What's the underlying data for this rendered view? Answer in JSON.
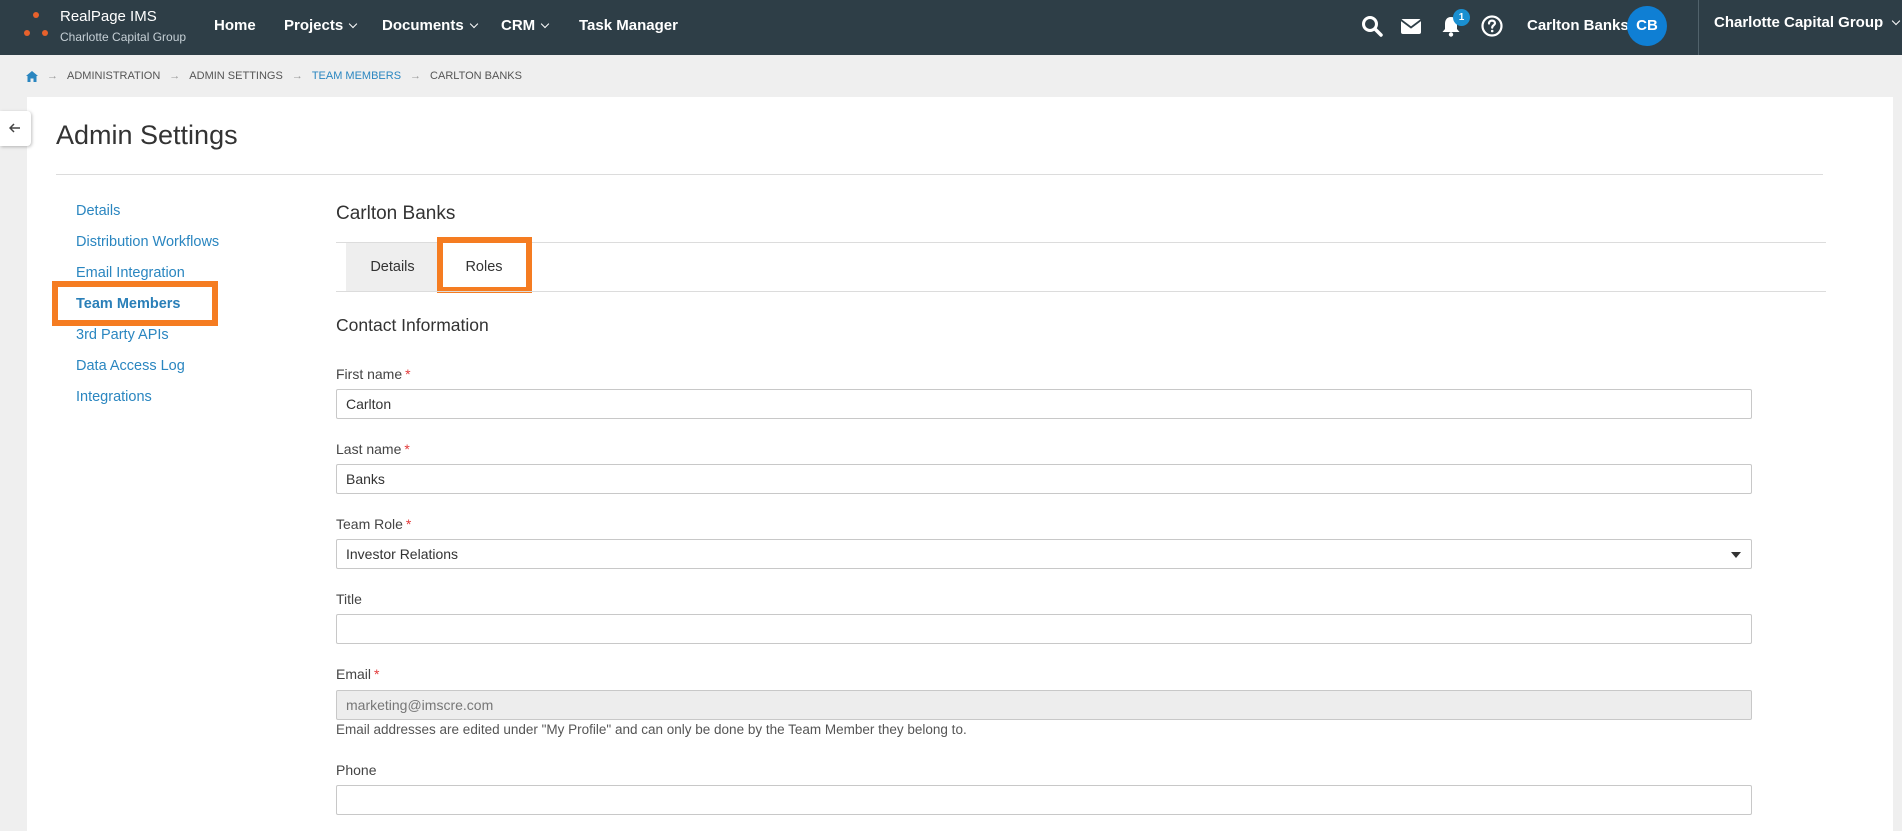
{
  "brand": {
    "name": "RealPage IMS",
    "subtitle": "Charlotte Capital Group"
  },
  "nav": [
    {
      "label": "Home"
    },
    {
      "label": "Projects"
    },
    {
      "label": "Documents"
    },
    {
      "label": "CRM"
    },
    {
      "label": "Task Manager"
    }
  ],
  "topbar": {
    "notification_count": "1",
    "user_name": "Carlton Banks",
    "user_initials": "CB",
    "org": "Charlotte Capital Group",
    "icons": [
      "search-icon",
      "mail-icon",
      "bell-icon",
      "help-icon"
    ]
  },
  "breadcrumb": [
    "ADMINISTRATION",
    "ADMIN SETTINGS",
    "TEAM MEMBERS",
    "CARLTON BANKS"
  ],
  "page": {
    "title": "Admin Settings"
  },
  "sidebar": {
    "items": [
      {
        "label": "Details"
      },
      {
        "label": "Distribution Workflows"
      },
      {
        "label": "Email Integration"
      },
      {
        "label": "Team Members"
      },
      {
        "label": "3rd Party APIs"
      },
      {
        "label": "Data Access Log"
      },
      {
        "label": "Integrations"
      }
    ]
  },
  "member": {
    "name": "Carlton Banks",
    "tabs": [
      {
        "label": "Details"
      },
      {
        "label": "Roles"
      }
    ],
    "section_title": "Contact Information"
  },
  "form": {
    "first_name": {
      "label": "First name",
      "value": "Carlton"
    },
    "last_name": {
      "label": "Last name",
      "value": "Banks"
    },
    "team_role": {
      "label": "Team Role",
      "value": "Investor Relations"
    },
    "title": {
      "label": "Title",
      "value": ""
    },
    "email": {
      "label": "Email",
      "value": "marketing@imscre.com",
      "help": "Email addresses are edited under \"My Profile\" and can only be done by the Team Member they belong to."
    },
    "phone": {
      "label": "Phone",
      "value": ""
    },
    "required_marker": "*"
  },
  "colors": {
    "topbar": "#2e3e47",
    "link": "#2a86c0",
    "highlight": "#f57c21",
    "avatar": "#0f7fd4",
    "brand_accent": "#e8612c"
  }
}
